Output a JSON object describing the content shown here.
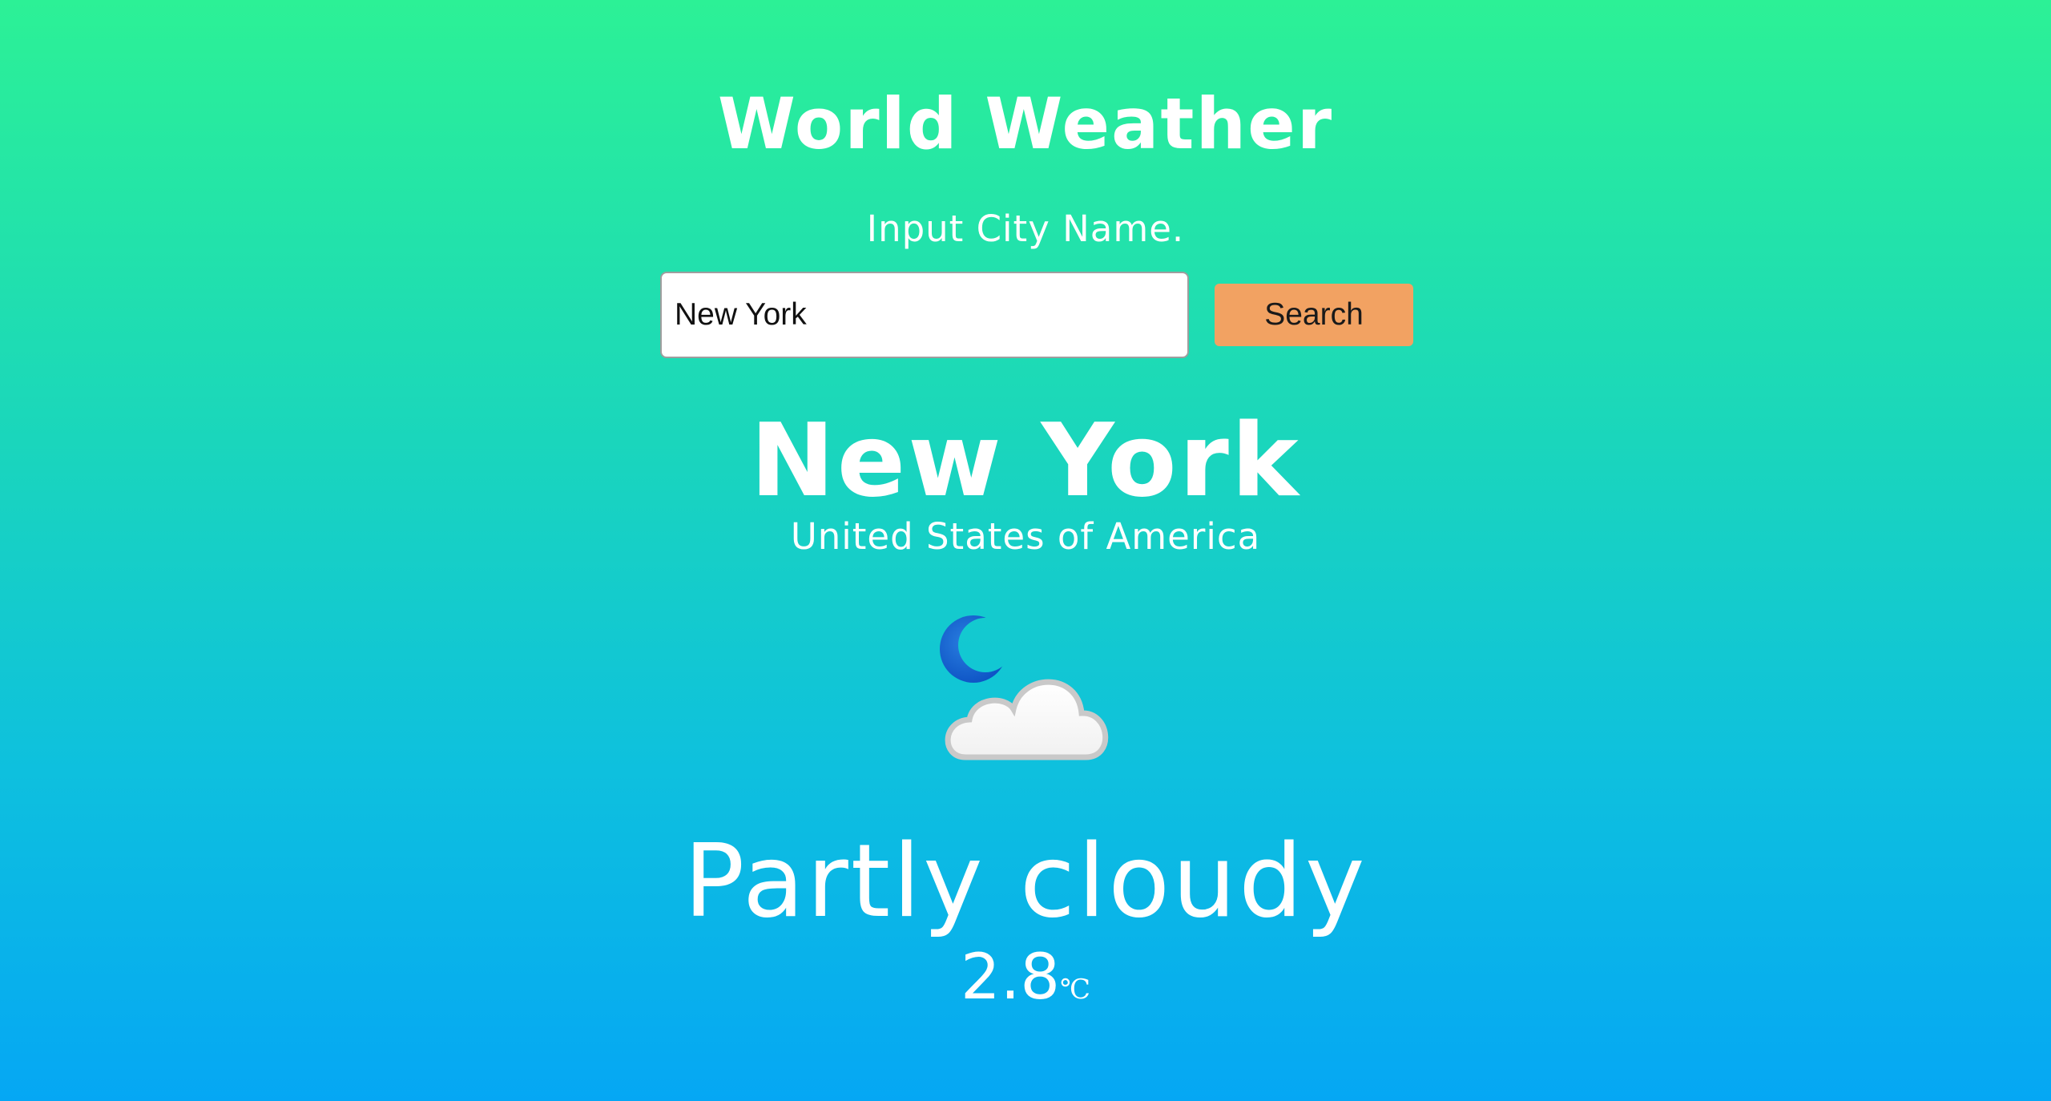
{
  "header": {
    "title": "World Weather"
  },
  "search": {
    "prompt": "Input City Name.",
    "value": "New York",
    "button_label": "Search"
  },
  "location": {
    "city": "New York",
    "country": "United States of America"
  },
  "weather": {
    "icon": "moon-cloud-icon",
    "condition": "Partly cloudy",
    "temperature": "2.8",
    "unit": "℃"
  },
  "colors": {
    "gradient_top": "#2cf196",
    "gradient_bottom": "#05a7f4",
    "button": "#f2a262",
    "text": "#ffffff"
  }
}
